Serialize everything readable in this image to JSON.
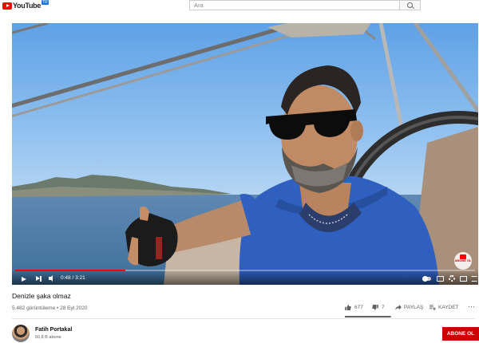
{
  "header": {
    "logo_text": "YouTube",
    "logo_country": "TR",
    "search_placeholder": "Ara"
  },
  "player": {
    "time_current": "0:48",
    "time_total": "3:21",
    "progress": 0.2388,
    "watermark_text": "ABONE OL",
    "colors": {
      "progress": "#ff0000",
      "watermark": "#cc0000"
    }
  },
  "video": {
    "title": "Denizle şaka olmaz",
    "views": "5.482 görüntüleme",
    "date": "28 Eyl 2020",
    "likes": "677",
    "dislikes": "7",
    "share_label": "PAYLAŞ",
    "save_label": "KAYDET",
    "more_label": "⋯",
    "like_ratio": 0.99
  },
  "channel": {
    "name": "Fatih Portakal",
    "subscribers": "50,8 B abone",
    "subscribe_label": "ABONE OL",
    "subscribe_color": "#cc0000"
  }
}
